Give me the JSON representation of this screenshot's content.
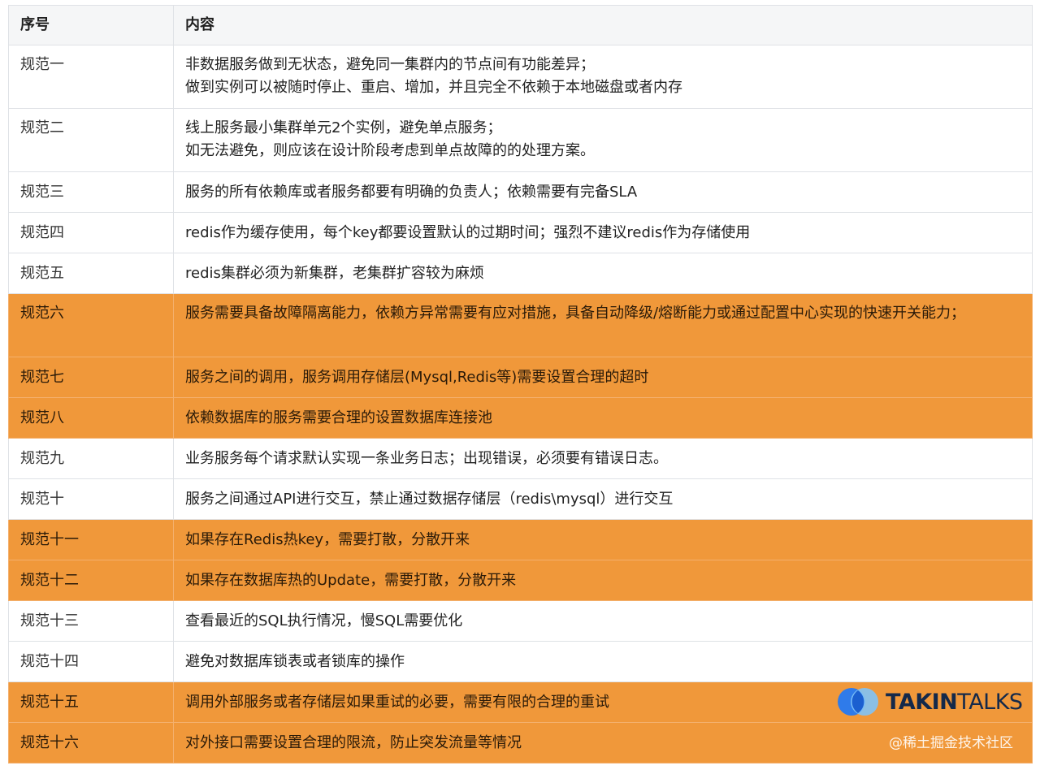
{
  "table": {
    "headers": [
      "序号",
      "内容"
    ],
    "rows": [
      {
        "num": "规范一",
        "lines": [
          "非数据服务做到无状态，避免同一集群内的节点间有功能差异；",
          "做到实例可以被随时停止、重启、增加，并且完全不依赖于本地磁盘或者内存"
        ],
        "highlighted": false
      },
      {
        "num": "规范二",
        "lines": [
          "线上服务最小集群单元2个实例，避免单点服务；",
          "如无法避免，则应该在设计阶段考虑到单点故障的的处理方案。"
        ],
        "highlighted": false
      },
      {
        "num": "规范三",
        "lines": [
          "服务的所有依赖库或者服务都要有明确的负责人；依赖需要有完备SLA"
        ],
        "highlighted": false
      },
      {
        "num": "规范四",
        "lines": [
          "redis作为缓存使用，每个key都要设置默认的过期时间；强烈不建议redis作为存储使用"
        ],
        "highlighted": false
      },
      {
        "num": "规范五",
        "lines": [
          "redis集群必须为新集群，老集群扩容较为麻烦"
        ],
        "highlighted": false
      },
      {
        "num": "规范六",
        "lines": [
          "服务需要具备故障隔离能力，依赖方异常需要有应对措施，具备自动降级/熔断能力或通过配置中心实现的快速开关能力；"
        ],
        "highlighted": true
      },
      {
        "num": "规范七",
        "lines": [
          "服务之间的调用，服务调用存储层(Mysql,Redis等)需要设置合理的超时"
        ],
        "highlighted": true
      },
      {
        "num": "规范八",
        "lines": [
          "依赖数据库的服务需要合理的设置数据库连接池"
        ],
        "highlighted": true
      },
      {
        "num": "规范九",
        "lines": [
          "业务服务每个请求默认实现一条业务日志；出现错误，必须要有错误日志。"
        ],
        "highlighted": false
      },
      {
        "num": "规范十",
        "lines": [
          "服务之间通过API进行交互，禁止通过数据存储层（redis\\mysql）进行交互"
        ],
        "highlighted": false
      },
      {
        "num": "规范十一",
        "lines": [
          "如果存在Redis热key，需要打散，分散开来"
        ],
        "highlighted": true
      },
      {
        "num": "规范十二",
        "lines": [
          "如果存在数据库热的Update，需要打散，分散开来"
        ],
        "highlighted": true
      },
      {
        "num": "规范十三",
        "lines": [
          "查看最近的SQL执行情况，慢SQL需要优化"
        ],
        "highlighted": false
      },
      {
        "num": "规范十四",
        "lines": [
          "避免对数据库锁表或者锁库的操作"
        ],
        "highlighted": false
      },
      {
        "num": "规范十五",
        "lines": [
          "调用外部服务或者存储层如果重试的必要，需要有限的合理的重试"
        ],
        "highlighted": true
      },
      {
        "num": "规范十六",
        "lines": [
          "对外接口需要设置合理的限流，防止突发流量等情况"
        ],
        "highlighted": true
      }
    ]
  },
  "logo": {
    "text_bold": "TAKIN",
    "text_light": "TALKS"
  },
  "watermark": "@稀土掘金技术社区",
  "colors": {
    "highlight_row": "#f0983a",
    "header_bg": "#f5f6f7",
    "border": "#dfe2e6",
    "logo_blue": "#2f7bea",
    "logo_light": "#7fc3f7",
    "logo_text": "#14294a"
  },
  "icons": {
    "logo": "takintalks-logo-icon"
  }
}
